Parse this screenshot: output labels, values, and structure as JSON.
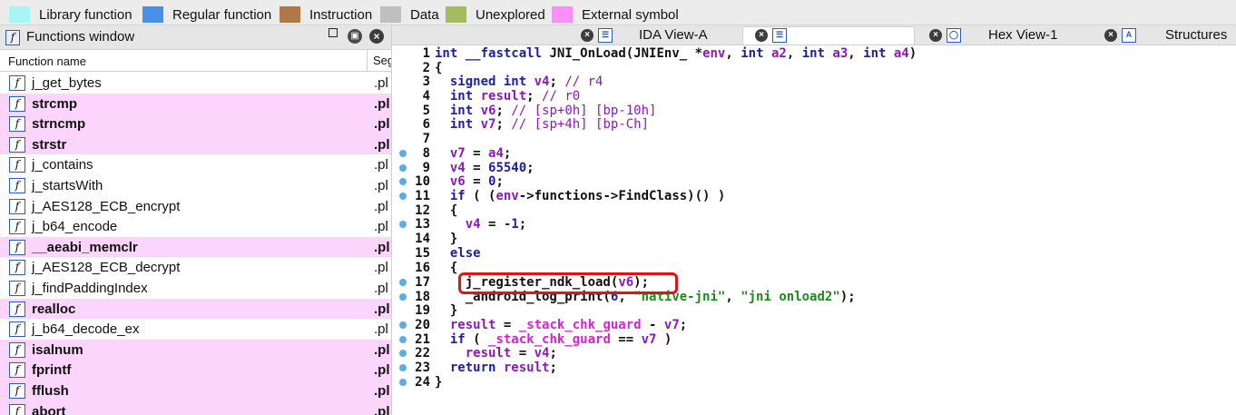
{
  "legend": [
    {
      "label": "Library function",
      "color": "#a9f4f4"
    },
    {
      "label": "Regular function",
      "color": "#4a90e8"
    },
    {
      "label": "Instruction",
      "color": "#b07846"
    },
    {
      "label": "Data",
      "color": "#bfbfbf"
    },
    {
      "label": "Unexplored",
      "color": "#a3bd5e"
    },
    {
      "label": "External symbol",
      "color": "#f990f9"
    }
  ],
  "functions_window": {
    "title": "Functions window",
    "icon": "function-icon",
    "col_name": "Function name",
    "col_segment": "Seg",
    "rows": [
      {
        "name": "j_get_bytes",
        "seg": ".pl",
        "external": false
      },
      {
        "name": "strcmp",
        "seg": ".pl",
        "external": true
      },
      {
        "name": "strncmp",
        "seg": ".pl",
        "external": true
      },
      {
        "name": "strstr",
        "seg": ".pl",
        "external": true
      },
      {
        "name": "j_contains",
        "seg": ".pl",
        "external": false
      },
      {
        "name": "j_startsWith",
        "seg": ".pl",
        "external": false
      },
      {
        "name": "j_AES128_ECB_encrypt",
        "seg": ".pl",
        "external": false
      },
      {
        "name": "j_b64_encode",
        "seg": ".pl",
        "external": false
      },
      {
        "name": "__aeabi_memclr",
        "seg": ".pl",
        "external": true
      },
      {
        "name": "j_AES128_ECB_decrypt",
        "seg": ".pl",
        "external": false
      },
      {
        "name": "j_findPaddingIndex",
        "seg": ".pl",
        "external": false
      },
      {
        "name": "realloc",
        "seg": ".pl",
        "external": true
      },
      {
        "name": "j_b64_decode_ex",
        "seg": ".pl",
        "external": false
      },
      {
        "name": "isalnum",
        "seg": ".pl",
        "external": true
      },
      {
        "name": "fprintf",
        "seg": ".pl",
        "external": true
      },
      {
        "name": "fflush",
        "seg": ".pl",
        "external": true
      },
      {
        "name": "abort",
        "seg": ".pl",
        "external": true
      }
    ]
  },
  "tabs": [
    {
      "label": "IDA View-A",
      "icon": "disassembly-icon",
      "active": false
    },
    {
      "label": "",
      "icon": "pseudocode-icon",
      "active": true
    },
    {
      "label": "Hex View-1",
      "icon": "hex-icon",
      "active": false
    },
    {
      "label": "Structures",
      "icon": "structures-icon",
      "active": false
    }
  ],
  "code": {
    "lines": [
      {
        "n": "1",
        "dot": false,
        "text": "int __fastcall JNI_OnLoad(JNIEnv_ *env, int a2, int a3, int a4)"
      },
      {
        "n": "2",
        "dot": false,
        "text": "{"
      },
      {
        "n": "3",
        "dot": false,
        "text": "  signed int v4; // r4"
      },
      {
        "n": "4",
        "dot": false,
        "text": "  int result; // r0"
      },
      {
        "n": "5",
        "dot": false,
        "text": "  int v6; // [sp+0h] [bp-10h]"
      },
      {
        "n": "6",
        "dot": false,
        "text": "  int v7; // [sp+4h] [bp-Ch]"
      },
      {
        "n": "7",
        "dot": false,
        "text": ""
      },
      {
        "n": "8",
        "dot": true,
        "text": "  v7 = a4;"
      },
      {
        "n": "9",
        "dot": true,
        "text": "  v4 = 65540;"
      },
      {
        "n": "10",
        "dot": true,
        "text": "  v6 = 0;"
      },
      {
        "n": "11",
        "dot": true,
        "text": "  if ( (env->functions->FindClass)() )"
      },
      {
        "n": "12",
        "dot": false,
        "text": "  {"
      },
      {
        "n": "13",
        "dot": true,
        "text": "    v4 = -1;"
      },
      {
        "n": "14",
        "dot": false,
        "text": "  }"
      },
      {
        "n": "15",
        "dot": false,
        "text": "  else"
      },
      {
        "n": "16",
        "dot": false,
        "text": "  {"
      },
      {
        "n": "17",
        "dot": true,
        "text": "    j_register_ndk_load(v6);"
      },
      {
        "n": "18",
        "dot": true,
        "text": "    _android_log_print(6, \"native-jni\", \"jni onload2\");"
      },
      {
        "n": "19",
        "dot": false,
        "text": "  }"
      },
      {
        "n": "20",
        "dot": true,
        "text": "  result = _stack_chk_guard - v7;"
      },
      {
        "n": "21",
        "dot": true,
        "text": "  if ( _stack_chk_guard == v7 )"
      },
      {
        "n": "22",
        "dot": true,
        "text": "    result = v4;"
      },
      {
        "n": "23",
        "dot": true,
        "text": "  return result;"
      },
      {
        "n": "24",
        "dot": true,
        "text": "}"
      }
    ]
  }
}
